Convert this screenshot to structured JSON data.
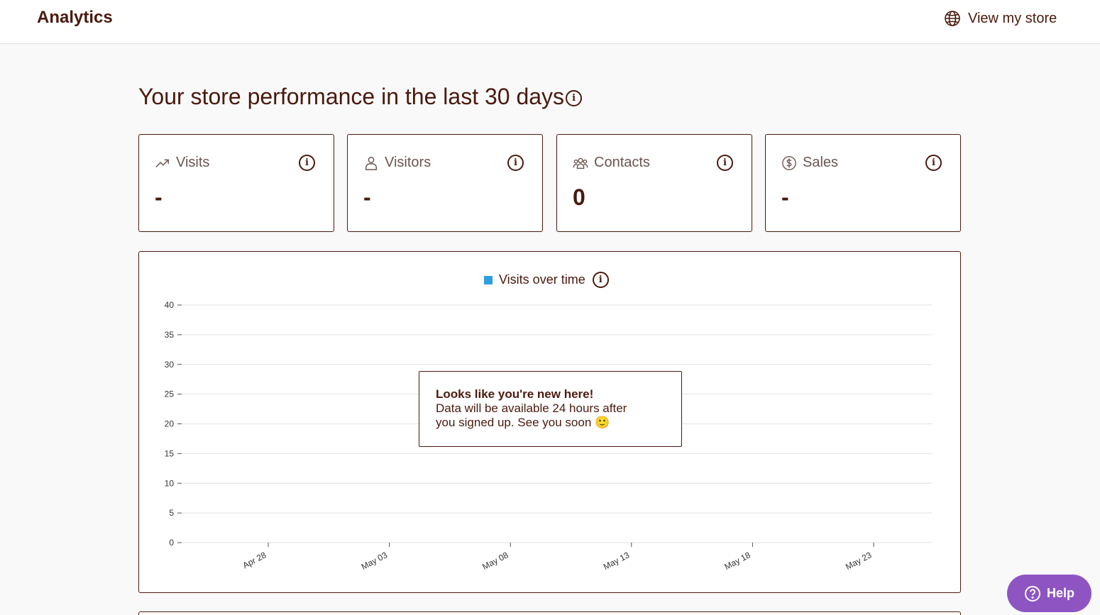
{
  "header": {
    "title": "Analytics",
    "view_store_label": "View my store",
    "view_store_icon": "globe-icon"
  },
  "main": {
    "heading": "Your store performance in the last 30 days",
    "stats": [
      {
        "label": "Visits",
        "value": "-",
        "icon": "trending-up-icon"
      },
      {
        "label": "Visitors",
        "value": "-",
        "icon": "user-icon"
      },
      {
        "label": "Contacts",
        "value": "0",
        "icon": "people-icon"
      },
      {
        "label": "Sales",
        "value": "-",
        "icon": "dollar-icon"
      }
    ]
  },
  "chart_data": {
    "type": "line",
    "title": "",
    "series": [
      {
        "name": "Visits over time",
        "color": "#2f9ee0",
        "values": []
      }
    ],
    "ylim": [
      0,
      40
    ],
    "y_ticks": [
      "0",
      "5",
      "10",
      "15",
      "20",
      "25",
      "30",
      "35",
      "40"
    ],
    "x_ticks": [
      "Apr 28",
      "May 03",
      "May 08",
      "May 13",
      "May 18",
      "May 23"
    ],
    "grid": true,
    "legend": "top-center"
  },
  "empty_state": {
    "title": "Looks like you're new here!",
    "message": "Data will be available 24 hours after\nyou signed up. See you soon 🙂"
  },
  "help": {
    "label": "Help",
    "icon": "question-circle-icon"
  }
}
